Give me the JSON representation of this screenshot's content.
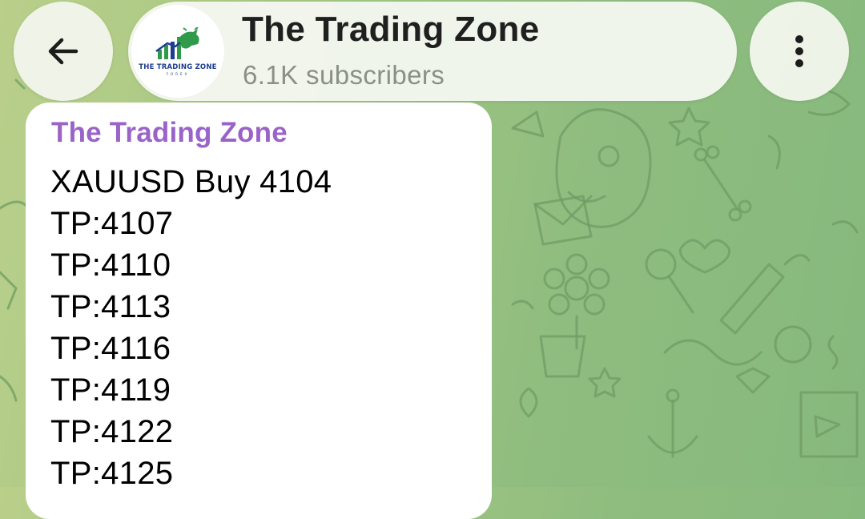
{
  "header": {
    "back_icon": "arrow-left-icon",
    "channel_avatar": {
      "logo_text": "THE TRADING ZONE",
      "logo_subtext": "FOREX",
      "icon": "bull-chart-logo"
    },
    "title": "The Trading Zone",
    "subtitle": "6.1K subscribers",
    "menu_icon": "more-vertical-icon"
  },
  "message": {
    "sender": "The Trading Zone",
    "lines": [
      "XAUUSD Buy 4104",
      "TP:4107",
      "TP:4110",
      "TP:4113",
      "TP:4116",
      "TP:4119",
      "TP:4122",
      "TP:4125"
    ]
  },
  "colors": {
    "sender_name": "#9a63c9",
    "wallpaper": "#8fbd7f",
    "bubble": "#ffffff"
  }
}
